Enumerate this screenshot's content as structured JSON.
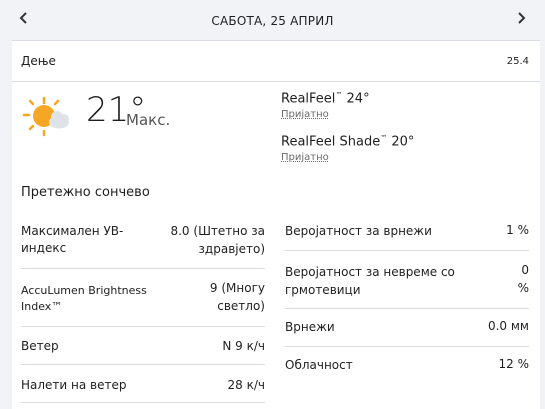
{
  "header": {
    "prev_icon": "chevron-left",
    "next_icon": "chevron-right",
    "date": "САБОТА, 25 АПРИЛ"
  },
  "period": {
    "label": "Дење",
    "date": "25.4"
  },
  "current": {
    "icon": "partly-sunny-icon",
    "temperature": "21°",
    "temp_kind": "Макс.",
    "realfeel_label": "RealFeel",
    "realfeel_value": " 24°",
    "realfeel_desc": "Пријатно",
    "realfeel_shade_label": "RealFeel Shade",
    "realfeel_shade_value": " 20°",
    "realfeel_shade_desc": "Пријатно",
    "tm": "™",
    "phrase": "Претежно сончево"
  },
  "details_left": [
    {
      "label": "Максимален УВ-индекс",
      "value": "8.0 (Штетно за здравјето)"
    },
    {
      "label": "AccuLumen Brightness Index™",
      "value": "9 (Многу светло)"
    },
    {
      "label": "Ветер",
      "value": "N 9 к/ч"
    },
    {
      "label": "Налети на ветер",
      "value": "28 к/ч"
    }
  ],
  "details_right": [
    {
      "label": "Веројатност за врнежи",
      "value": "1 %"
    },
    {
      "label": "Веројатност за невреме со грмотевици",
      "value": "0 %"
    },
    {
      "label": "Врнежи",
      "value": "0.0 мм"
    },
    {
      "label": "Облачност",
      "value": "12 %"
    }
  ],
  "colors": {
    "sun": "#f5a623",
    "cloud": "#dfe3e8",
    "background": "#f1f3f7",
    "divider": "#d9dde3"
  }
}
